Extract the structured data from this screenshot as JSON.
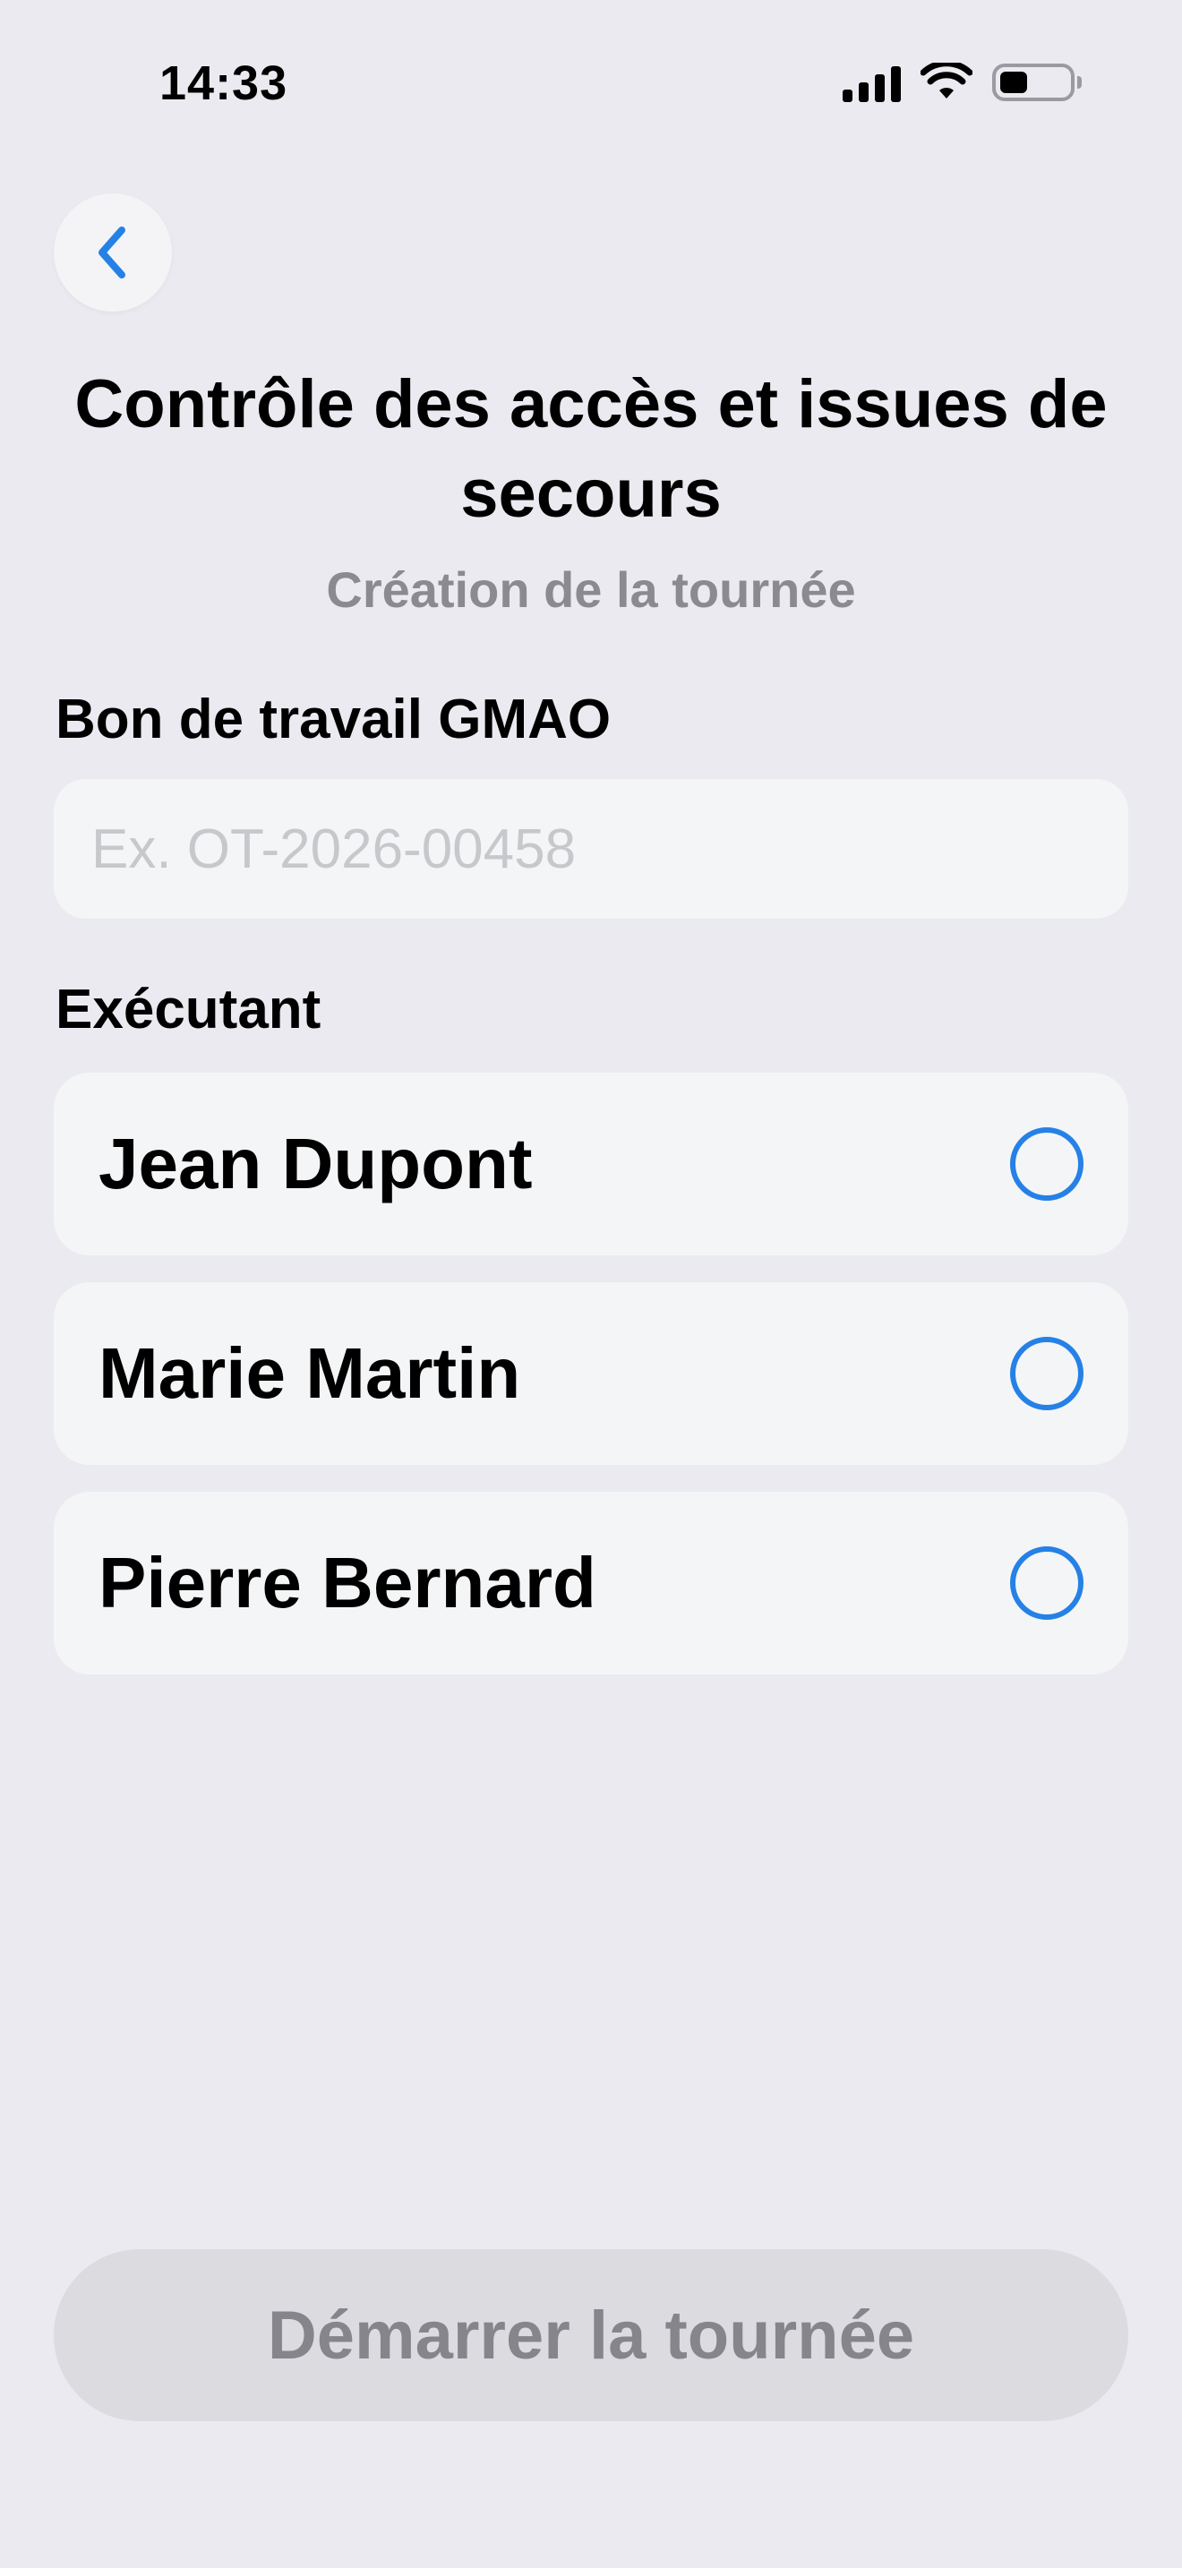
{
  "status_bar": {
    "time": "14:33",
    "icons": [
      "cellular-signal-icon",
      "wifi-icon",
      "battery-icon"
    ]
  },
  "header": {
    "back_icon": "chevron-left-icon",
    "title": "Contrôle des accès et issues de secours",
    "subtitle": "Création de la tournée"
  },
  "form": {
    "work_order": {
      "label": "Bon de travail GMAO",
      "placeholder": "Ex. OT-2026-00458",
      "value": ""
    },
    "executor": {
      "label": "Exécutant",
      "options": [
        {
          "label": "Jean Dupont",
          "selected": false
        },
        {
          "label": "Marie Martin",
          "selected": false
        },
        {
          "label": "Pierre Bernard",
          "selected": false
        }
      ]
    }
  },
  "actions": {
    "start_label": "Démarrer la tournée",
    "start_enabled": false
  },
  "colors": {
    "background": "#EBEAF0",
    "accent": "#2581E6",
    "card": "#F4F5F6",
    "subtitle": "#8A8A90",
    "disabled_button": "#DCDBE0",
    "disabled_text": "#85858B"
  }
}
